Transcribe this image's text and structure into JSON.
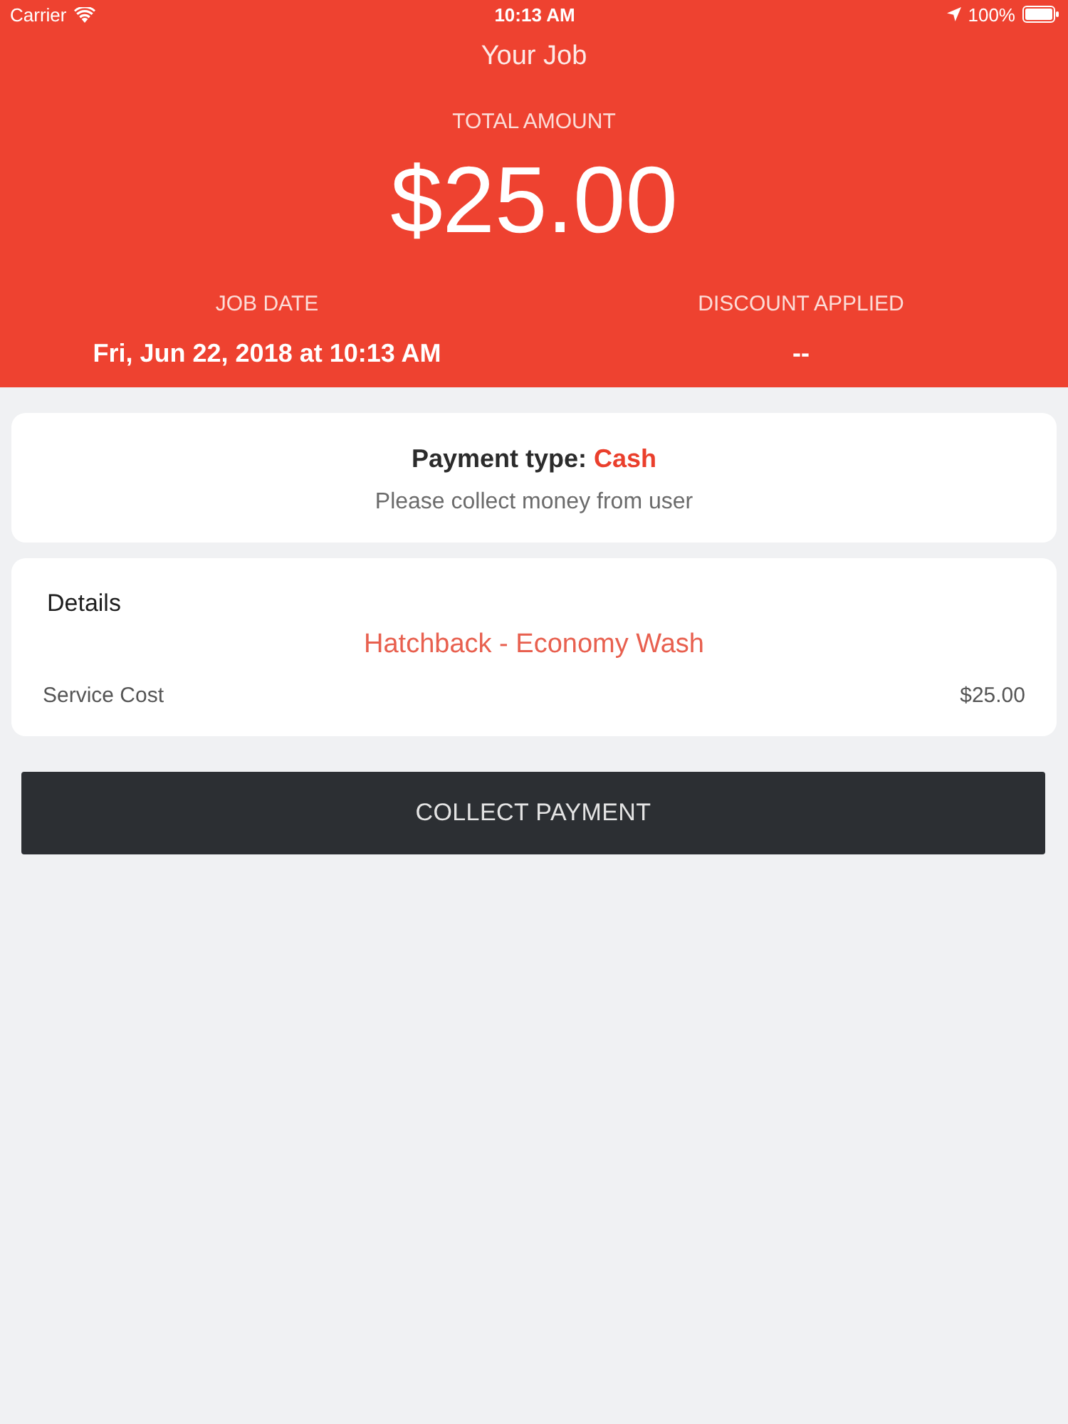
{
  "status_bar": {
    "carrier": "Carrier",
    "time": "10:13 AM",
    "battery": "100%"
  },
  "header": {
    "title": "Your Job",
    "total_label": "TOTAL AMOUNT",
    "total_amount": "$25.00",
    "stats": [
      {
        "label": "JOB DATE",
        "value": "Fri, Jun 22, 2018 at 10:13 AM"
      },
      {
        "label": "DISCOUNT APPLIED",
        "value": "--"
      }
    ]
  },
  "payment_card": {
    "label": "Payment type:",
    "value": "Cash",
    "note": "Please collect money from user"
  },
  "details_card": {
    "title": "Details",
    "service": "Hatchback - Economy Wash",
    "rows": [
      {
        "label": "Service Cost",
        "value": "$25.00"
      }
    ]
  },
  "button": {
    "label": "COLLECT PAYMENT"
  }
}
